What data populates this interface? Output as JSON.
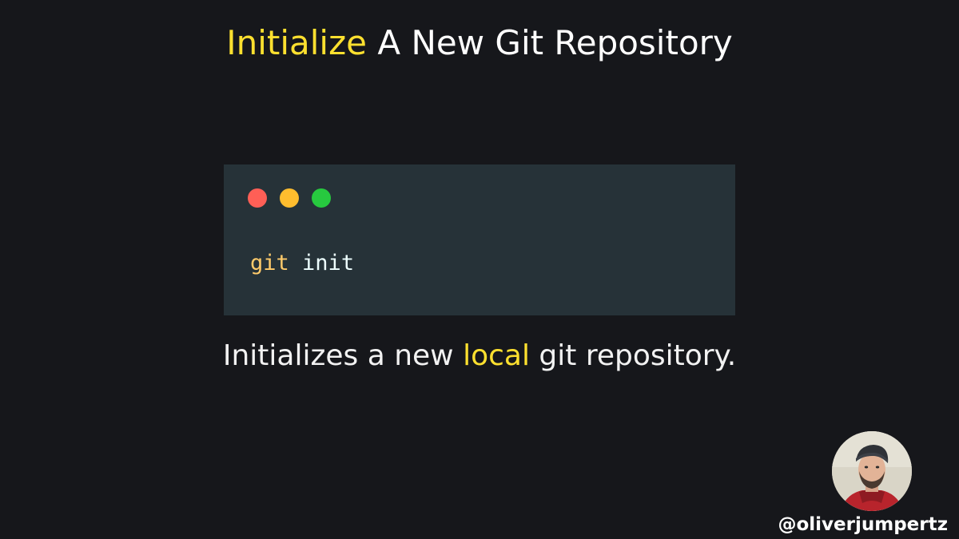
{
  "title": {
    "highlight": "Initialize",
    "rest": "A New Git Repository"
  },
  "code": {
    "command": "git",
    "argument": "init"
  },
  "description": {
    "before": "Initializes a new",
    "highlight": "local",
    "after": "git repository."
  },
  "author": {
    "handle": "@oliverjumpertz"
  },
  "colors": {
    "background": "#16171b",
    "accent": "#fde02f",
    "code_background": "#263238",
    "window_red": "#ff5f56",
    "window_yellow": "#ffbd2e",
    "window_green": "#27c93f"
  }
}
